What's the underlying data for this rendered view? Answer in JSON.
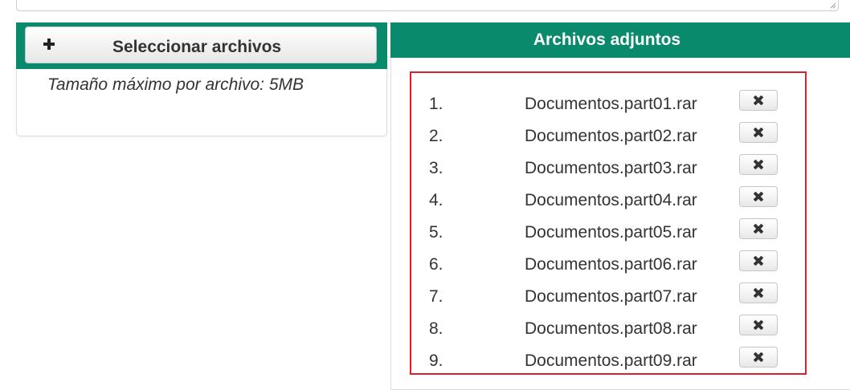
{
  "upload": {
    "select_button_label": "Seleccionar archivos",
    "max_size_note": "Tamaño máximo por archivo: 5MB"
  },
  "attachments": {
    "title": "Archivos adjuntos",
    "items": [
      {
        "number": "1.",
        "filename": "Documentos.part01.rar"
      },
      {
        "number": "2.",
        "filename": "Documentos.part02.rar"
      },
      {
        "number": "3.",
        "filename": "Documentos.part03.rar"
      },
      {
        "number": "4.",
        "filename": "Documentos.part04.rar"
      },
      {
        "number": "5.",
        "filename": "Documentos.part05.rar"
      },
      {
        "number": "6.",
        "filename": "Documentos.part06.rar"
      },
      {
        "number": "7.",
        "filename": "Documentos.part07.rar"
      },
      {
        "number": "8.",
        "filename": "Documentos.part08.rar"
      },
      {
        "number": "9.",
        "filename": "Documentos.part09.rar"
      }
    ]
  },
  "icons": {
    "add": "plus-icon",
    "remove": "times-icon",
    "resize": "resize-grip-icon"
  },
  "colors": {
    "header_green": "#0a8a6d",
    "highlight_red": "#e11f2a"
  }
}
